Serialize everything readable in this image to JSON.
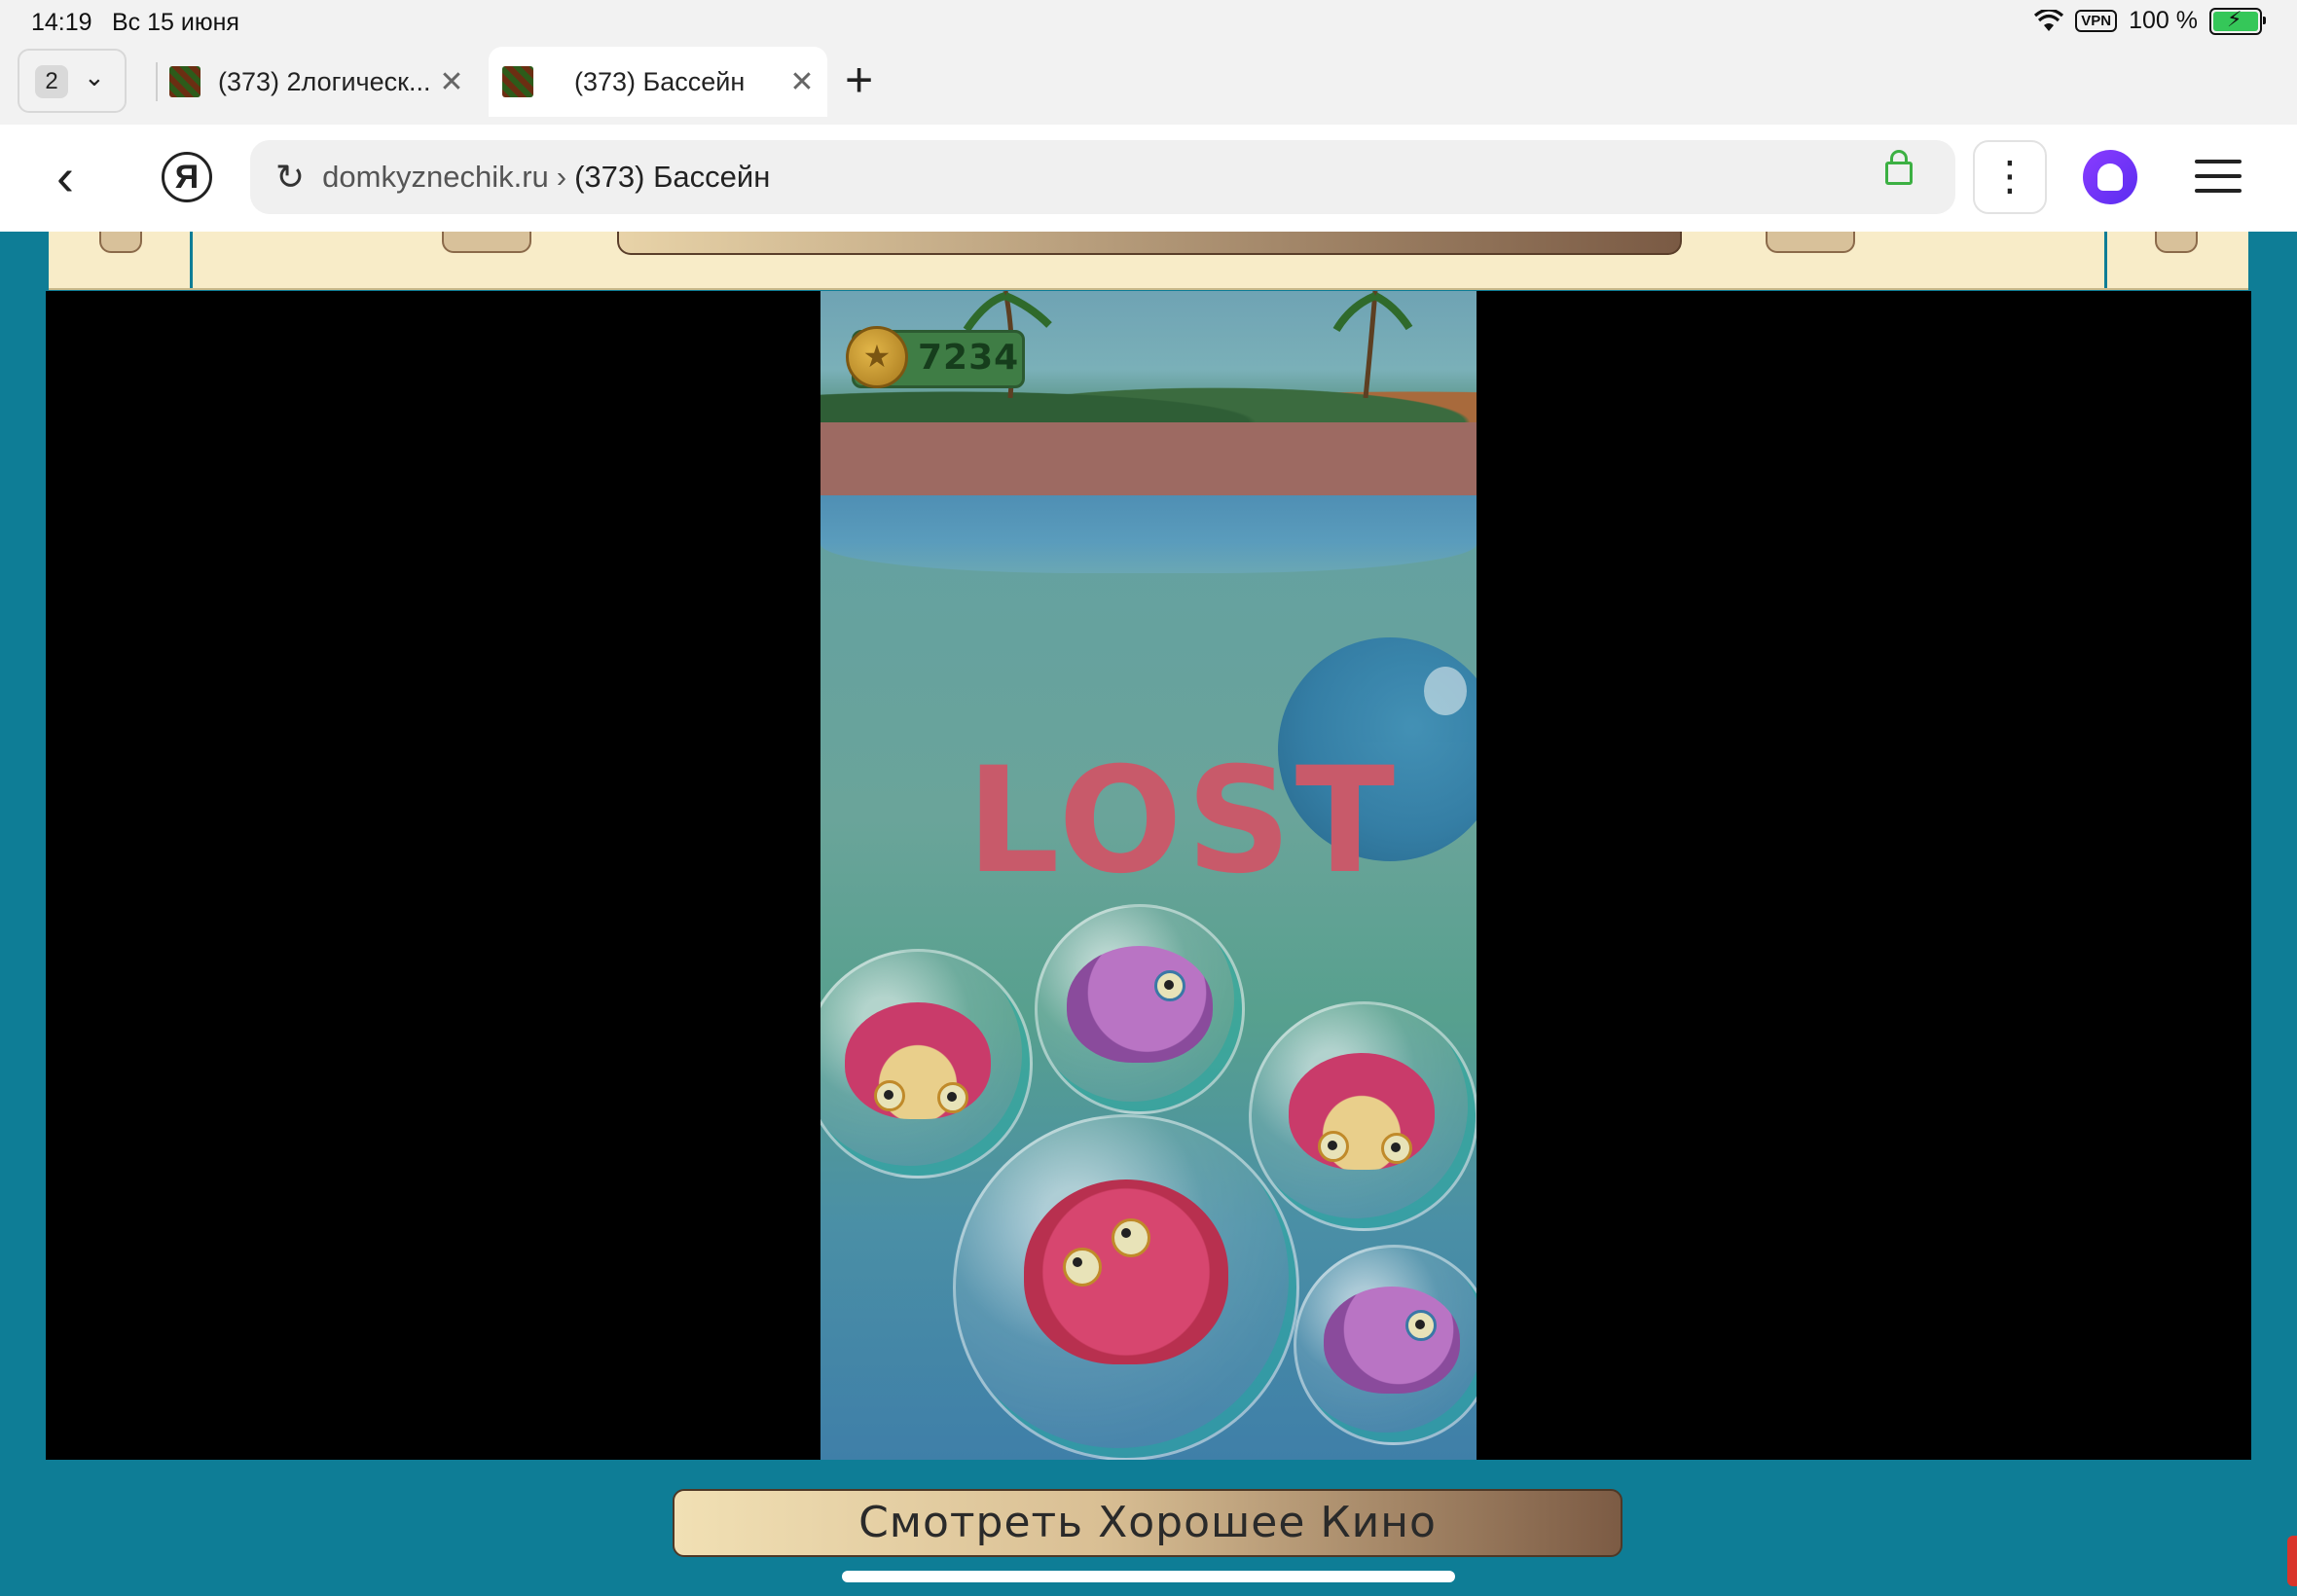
{
  "status_bar": {
    "time": "14:19",
    "date": "Вс 15 июня",
    "vpn": "VPN",
    "battery": "100 %",
    "icons": [
      "wifi-icon",
      "battery-charging-icon"
    ]
  },
  "tabs": {
    "count": "2",
    "items": [
      {
        "label": "(373) 2логическ...",
        "active": false
      },
      {
        "label": "(373) Бассейн",
        "active": true
      }
    ],
    "new_tab": "+"
  },
  "toolbar": {
    "back": "‹",
    "yandex_logo": "Я",
    "url_domain": "domkyznechik.ru",
    "url_separator": "›",
    "url_page": "(373) Бассейн",
    "menu": "⋮"
  },
  "game": {
    "coins": "7234",
    "status_text": "LOST"
  },
  "page": {
    "bottom_button": "Смотреть Хорошее Кино"
  },
  "colors": {
    "page_background": "#0e7d96",
    "lost_text": "#c85a6a",
    "lock_green": "#3cb043"
  }
}
